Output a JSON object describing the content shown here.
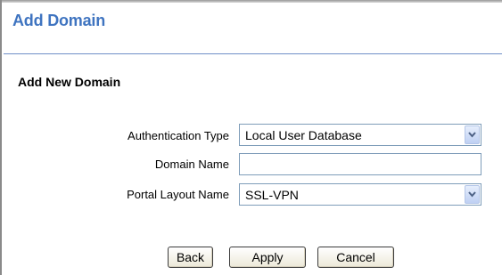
{
  "header": {
    "title": "Add Domain"
  },
  "section": {
    "title": "Add New Domain"
  },
  "form": {
    "authentication_type": {
      "label": "Authentication Type",
      "selected": "Local User Database"
    },
    "domain_name": {
      "label": "Domain Name",
      "value": ""
    },
    "portal_layout_name": {
      "label": "Portal Layout Name",
      "selected": "SSL-VPN"
    }
  },
  "actions": {
    "back_label": "Back",
    "apply_label": "Apply",
    "cancel_label": "Cancel"
  },
  "colors": {
    "title": "#3f74c0",
    "divider": "#6f8fc7",
    "field_border": "#7f9db9"
  },
  "icons": {
    "dropdown": "chevron-down-icon"
  }
}
